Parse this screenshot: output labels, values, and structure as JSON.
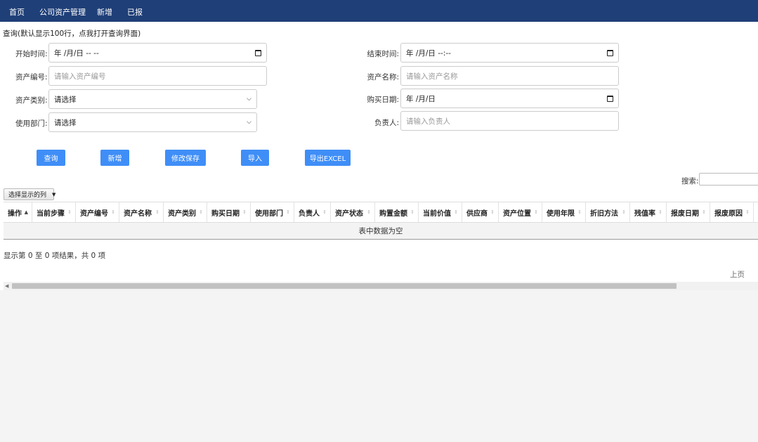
{
  "nav": {
    "items": [
      "首页",
      "公司资产管理",
      "新增",
      "已报"
    ]
  },
  "query_hint": "查询(默认显示100行，点我打开查询界面)",
  "form": {
    "start_time": {
      "label": "开始时间:",
      "value": "年 /月/日 -- --"
    },
    "end_time": {
      "label": "结束时间:",
      "value": "年 /月/日 --:--"
    },
    "asset_no": {
      "label": "资产编号:",
      "placeholder": "请输入资产编号"
    },
    "asset_name": {
      "label": "资产名称:",
      "placeholder": "请输入资产名称"
    },
    "asset_type": {
      "label": "资产类别:",
      "value": "请选择"
    },
    "purchase_date": {
      "label": "购买日期:",
      "value": "年 /月/日"
    },
    "department": {
      "label": "使用部门:",
      "value": "请选择"
    },
    "owner": {
      "label": "负责人:",
      "placeholder": "请输入负责人"
    }
  },
  "buttons": [
    "查询",
    "新增",
    "修改保存",
    "导入",
    "导出EXCEL"
  ],
  "table": {
    "search_label": "搜索:",
    "column_visibility_label": "选择显示的列",
    "columns": [
      "操作",
      "当前步骤",
      "资产编号",
      "资产名称",
      "资产类别",
      "购买日期",
      "使用部门",
      "负责人",
      "资产状态",
      "购置金额",
      "当前价值",
      "供应商",
      "资产位置",
      "使用年限",
      "折旧方法",
      "残值率",
      "报废日期",
      "报废原因"
    ],
    "empty_message": "表中数据为空",
    "info": "显示第 0 至 0 项结果，共 0 项",
    "prev_label": "上页"
  },
  "colors": {
    "navbar": "#1f3f78",
    "button": "#3f8ef7"
  }
}
